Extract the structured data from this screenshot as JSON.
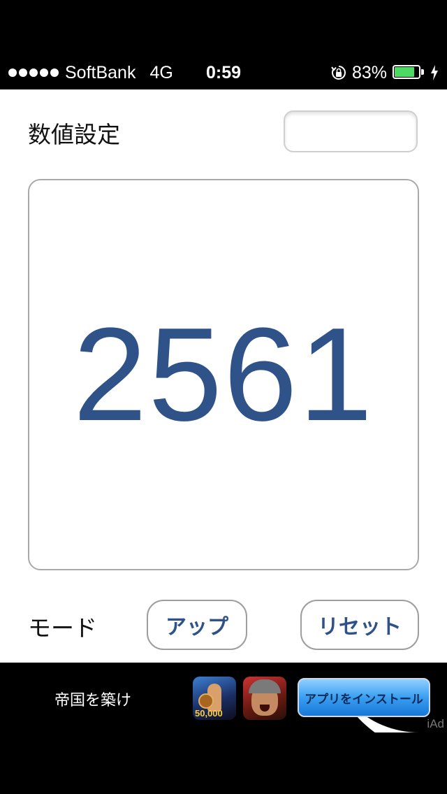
{
  "status_bar": {
    "carrier": "SoftBank",
    "network": "4G",
    "time": "0:59",
    "battery_percent": "83%",
    "battery_level": 0.83,
    "colors": {
      "battery": "#4cd964"
    }
  },
  "app": {
    "setting_label": "数値設定",
    "setting_input_value": "",
    "counter_value": "2561",
    "mode_label": "モード",
    "up_button": "アップ",
    "reset_button": "リセット",
    "colors": {
      "accent": "#2f5289"
    }
  },
  "ad": {
    "text": "帝国を築け",
    "game_icons": [
      {
        "name": "spartan-game-icon",
        "badge": "50,000"
      },
      {
        "name": "warrior-game-icon"
      }
    ],
    "install_button": "アプリをインストール",
    "badge": "iAd"
  }
}
